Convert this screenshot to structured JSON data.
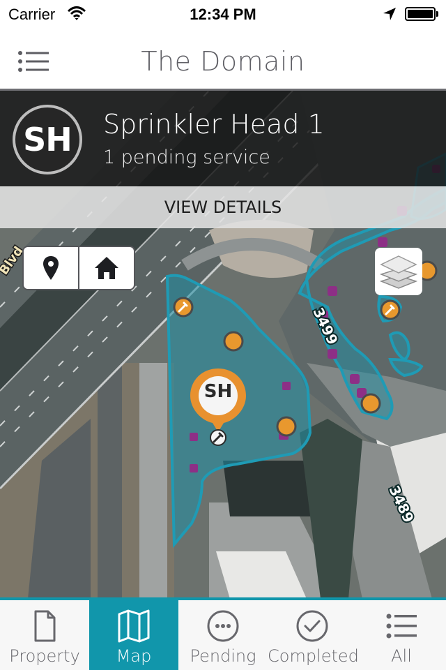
{
  "status_bar": {
    "carrier": "Carrier",
    "time": "12:34 PM",
    "wifi_icon": "wifi-icon",
    "location_icon": "location-arrow-icon",
    "battery_icon": "battery-full-icon"
  },
  "nav": {
    "title": "The Domain",
    "menu_icon": "list-menu-icon"
  },
  "asset": {
    "initials": "SH",
    "name": "Sprinkler Head 1",
    "subtitle": "1 pending service",
    "view_details_label": "VIEW DETAILS"
  },
  "map": {
    "controls": [
      {
        "icon": "map-pin-icon",
        "name": "locate-button"
      },
      {
        "icon": "home-icon",
        "name": "home-button"
      }
    ],
    "layers_icon": "layers-icon",
    "selected_marker_label": "SH",
    "street_labels": [
      "Blvd",
      "3499",
      "3489"
    ],
    "colors": {
      "zone_outline": "#1f9bb5",
      "zone_fill": "#1f8fa6",
      "asset_marker": "#e8982e",
      "pending_marker": "#8d2f86"
    }
  },
  "tabs": [
    {
      "label": "Property",
      "icon": "document-icon",
      "active": false
    },
    {
      "label": "Map",
      "icon": "map-icon",
      "active": true
    },
    {
      "label": "Pending",
      "icon": "ellipsis-circle-icon",
      "active": false
    },
    {
      "label": "Completed",
      "icon": "check-circle-icon",
      "active": false
    },
    {
      "label": "All",
      "icon": "list-icon",
      "active": false
    }
  ],
  "theme": {
    "accent": "#1196ab",
    "title_gray": "#606066"
  }
}
